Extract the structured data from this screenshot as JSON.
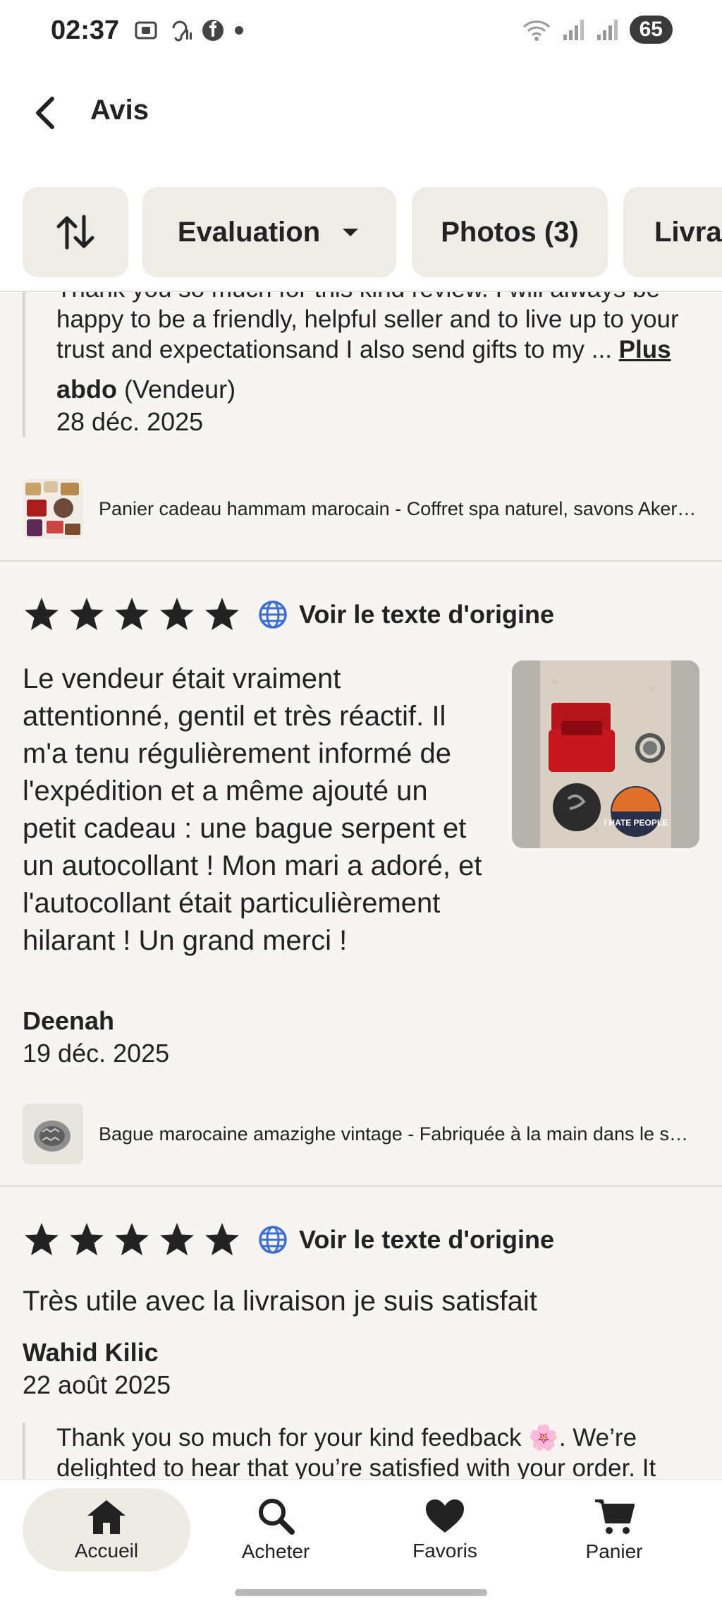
{
  "status_bar": {
    "time": "02:37",
    "battery": "65",
    "icons_left": [
      "screenshot-icon",
      "hearing-icon",
      "facebook-icon",
      "dot-icon"
    ],
    "icons_right": [
      "wifi-icon",
      "signal-icon",
      "signal-icon"
    ]
  },
  "header": {
    "title": "Avis",
    "back_icon": "chevron-left-icon"
  },
  "filters": {
    "sort_icon": "sort-arrows-icon",
    "evaluation_label": "Evaluation",
    "photos_label": "Photos (3)",
    "livraison_label": "Livrai"
  },
  "reply1": {
    "text": "Thank you so much for this kind review. I will always be happy to be a friendly, helpful seller and to live up to your trust and expectationsand I also send gifts to my ... ",
    "more_label": "Plus",
    "author": "abdo",
    "author_role": "(Vendeur)",
    "date": "28 déc. 2025"
  },
  "product1": {
    "title": "Panier cadeau hammam marocain - Coffret spa naturel, savons Aker F..."
  },
  "review2": {
    "rating": 5,
    "translate_label": "Voir le texte d'origine",
    "text": "Le vendeur était vraiment attentionné, gentil et très réactif. Il m'a tenu régulièrement informé de l'expédition et a même ajouté un petit cadeau : une bague serpent et un autocollant ! Mon mari a adoré, et l'autocollant était particulièrement hilarant ! Un grand merci !",
    "author": "Deenah",
    "date": "19 déc. 2025",
    "photo_sticker_text": "I HATE PEOPLE"
  },
  "product2": {
    "title": "Bague marocaine amazighe vintage - Fabriquée à la main dans le sud ..."
  },
  "review3": {
    "rating": 5,
    "translate_label": "Voir le texte d'origine",
    "text": "Très utile avec la livraison je suis satisfait",
    "author": "Wahid Kilic",
    "date": "22 août 2025"
  },
  "reply3": {
    "text": "Thank you so much for your kind feedback 🌸. We’re delighted to hear that you’re satisfied with your order. It"
  },
  "bottom_nav": {
    "items": [
      {
        "label": "Accueil",
        "icon": "home-icon"
      },
      {
        "label": "Acheter",
        "icon": "search-icon"
      },
      {
        "label": "Favoris",
        "icon": "heart-icon"
      },
      {
        "label": "Panier",
        "icon": "cart-icon"
      }
    ]
  },
  "colors": {
    "background": "#f6f5f1",
    "surface": "#ffffff",
    "chip": "#eeece7",
    "text": "#222222",
    "globe": "#3d6fd1"
  }
}
